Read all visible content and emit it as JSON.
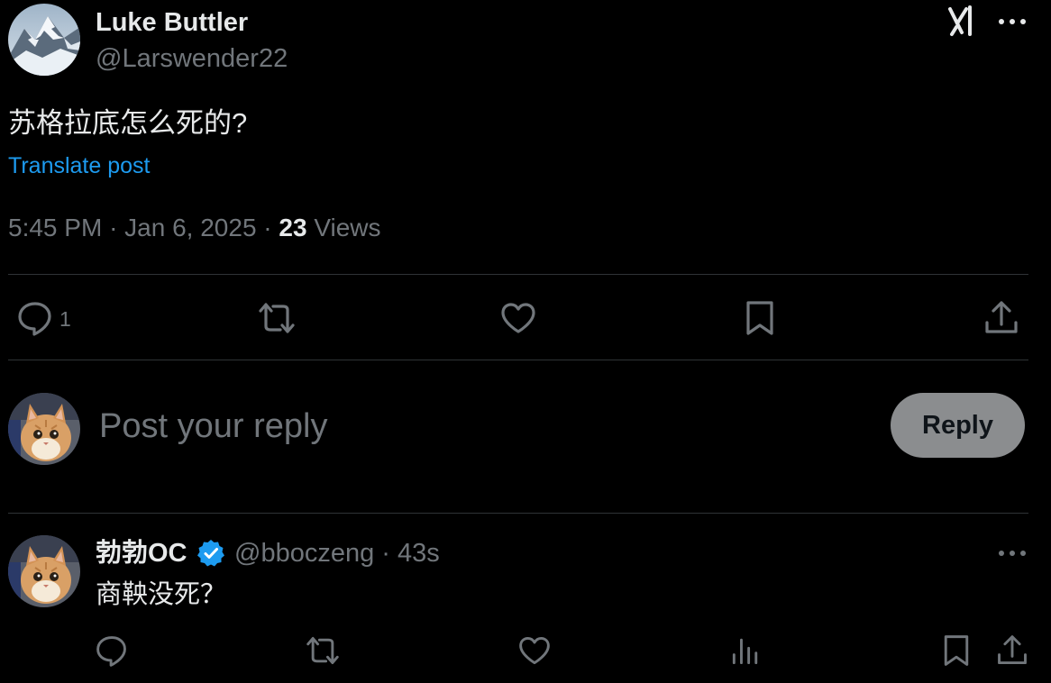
{
  "post": {
    "author_name": "Luke Buttler",
    "author_handle": "@Larswender22",
    "text": "苏格拉底怎么死的?",
    "translate_label": "Translate post",
    "time": "5:45 PM",
    "separator": "·",
    "date": "Jan 6, 2025",
    "views_count": "23",
    "views_label": "Views",
    "actions": {
      "reply_count": "1"
    }
  },
  "composer": {
    "placeholder": "Post your reply",
    "reply_button_label": "Reply"
  },
  "reply_tweet": {
    "author_name": "勃勃OC",
    "author_handle": "@bboczeng",
    "time_ago": "43s",
    "text": "商鞅没死？"
  },
  "icons": {
    "grok": "grok-icon",
    "more": "more-horizontal-icon",
    "reply": "reply-bubble-icon",
    "retweet": "retweet-icon",
    "like": "heart-icon",
    "bookmark": "bookmark-icon",
    "share": "share-upload-icon",
    "views": "analytics-bars-icon",
    "verified": "verified-badge-icon"
  },
  "colors": {
    "background": "#000000",
    "text_primary": "#e7e9ea",
    "text_secondary": "#71767b",
    "link": "#1d9bf0",
    "divider": "#2f3336",
    "verified": "#1d9bf0",
    "reply_button_bg": "#8b8d8f"
  }
}
